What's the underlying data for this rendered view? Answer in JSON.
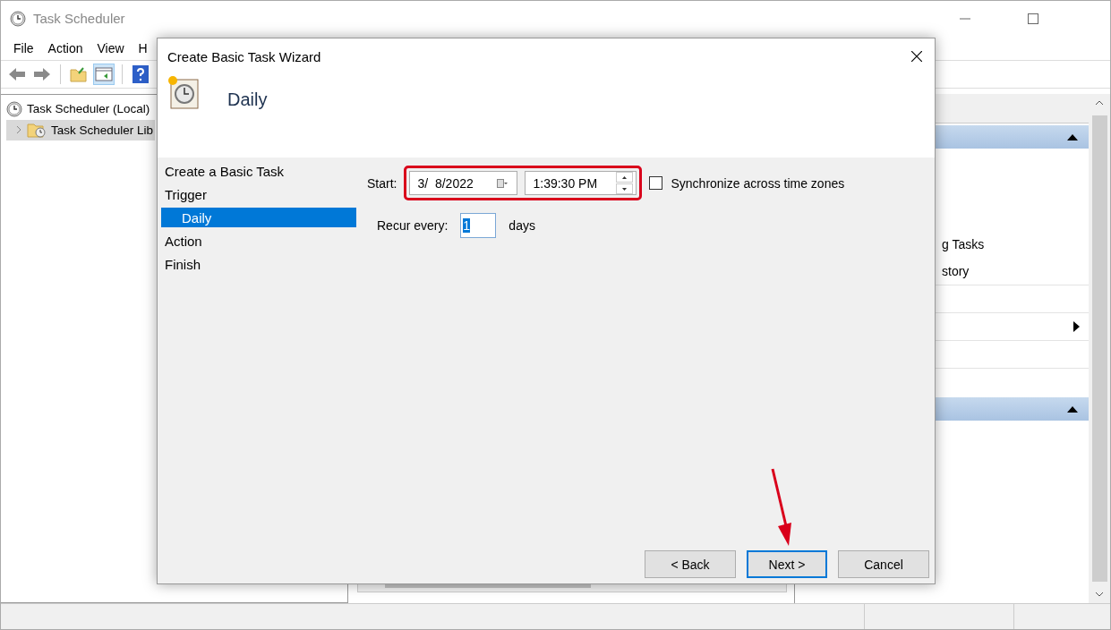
{
  "main_window": {
    "title": "Task Scheduler",
    "menu": [
      "File",
      "Action",
      "View",
      "H"
    ],
    "tree": [
      {
        "label": "Task Scheduler (Local)",
        "selected": false,
        "children": [
          {
            "label": "Task Scheduler Lib",
            "selected": true,
            "expanded": false
          }
        ]
      }
    ],
    "actions": [
      "g Tasks",
      "story"
    ]
  },
  "wizard": {
    "title": "Create Basic Task Wizard",
    "heading": "Daily",
    "steps": [
      {
        "label": "Create a Basic Task",
        "selected": false
      },
      {
        "label": "Trigger",
        "selected": false,
        "children": [
          {
            "label": "Daily",
            "selected": true
          }
        ]
      },
      {
        "label": "Action",
        "selected": false
      },
      {
        "label": "Finish",
        "selected": false
      }
    ],
    "start_label": "Start:",
    "date": "3/  8/2022",
    "time": "1:39:30 PM",
    "sync": {
      "label": "Synchronize across time zones",
      "checked": false
    },
    "recur_label": "Recur every:",
    "recur_value": "1",
    "recur_unit": "days",
    "buttons": [
      {
        "label": "< Back",
        "default": false
      },
      {
        "label": "Next >",
        "default": true
      },
      {
        "label": "Cancel",
        "default": false
      }
    ]
  }
}
